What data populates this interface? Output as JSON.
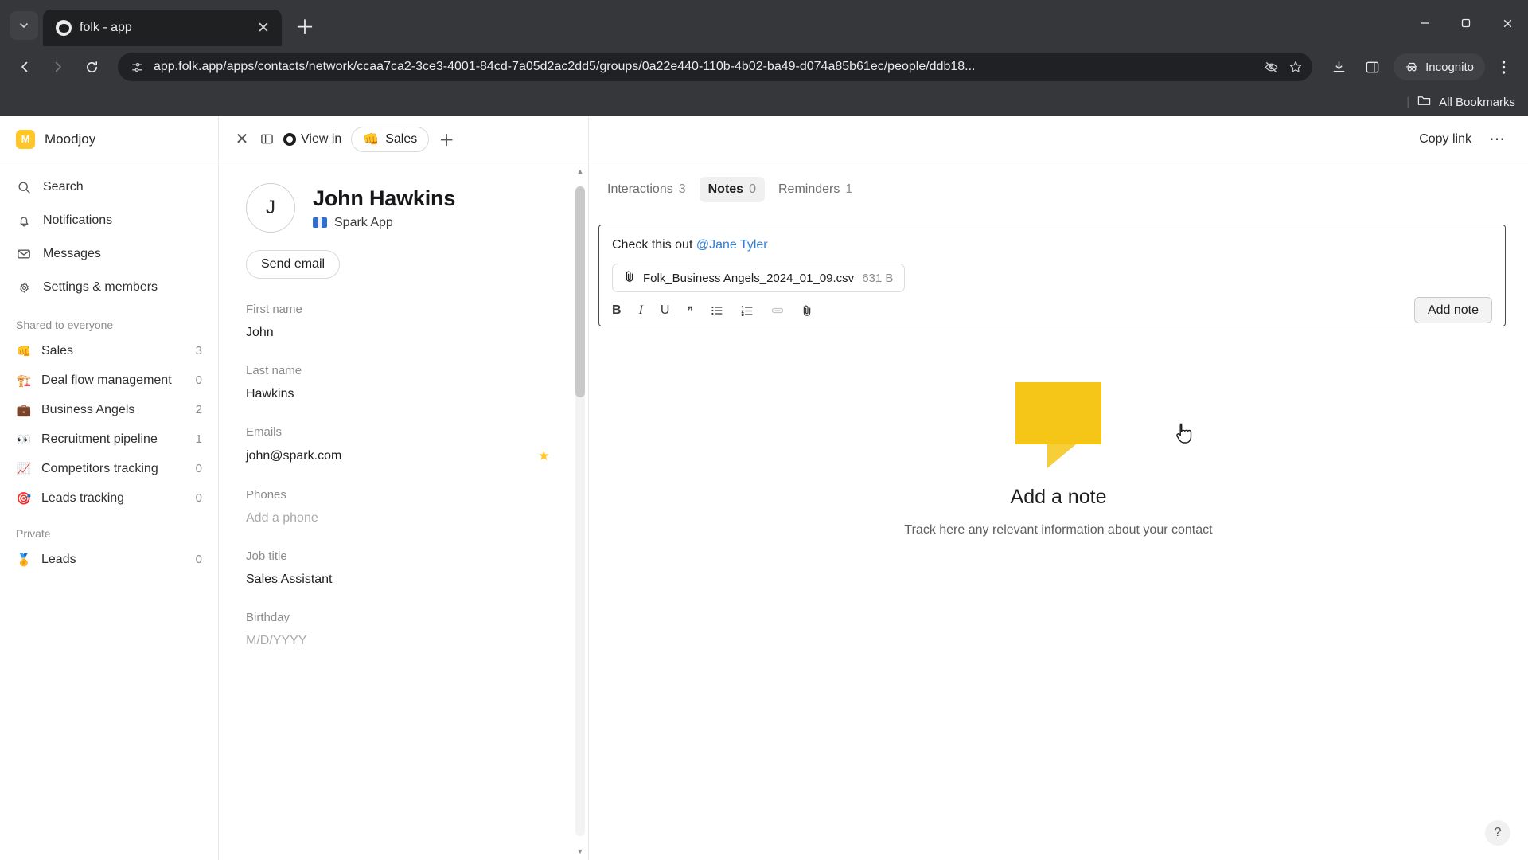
{
  "browser": {
    "tab": {
      "title": "folk - app",
      "favicon_icon": "folk-logo-icon",
      "close_icon": "close-icon"
    },
    "tab_search_icon": "chevron-down-icon",
    "new_tab_icon": "plus-icon",
    "window": {
      "minimize": "minimize-icon",
      "maximize": "maximize-icon",
      "close": "close-icon"
    },
    "nav": {
      "back_icon": "back-arrow-icon",
      "forward_icon": "forward-arrow-icon",
      "reload_icon": "reload-icon"
    },
    "omnibox": {
      "site_info_icon": "page-info-icon",
      "url": "app.folk.app/apps/contacts/network/ccaa7ca2-3ce3-4001-84cd-7a05d2ac2dd5/groups/0a22e440-110b-4b02-ba49-d074a85b61ec/people/ddb18...",
      "tracking_icon": "eye-off-icon",
      "bookmark_icon": "star-icon"
    },
    "actions": {
      "download_icon": "download-icon",
      "side_panel_icon": "side-panel-icon",
      "incognito_label": "Incognito",
      "incognito_icon": "incognito-icon",
      "menu_icon": "kebab-menu-icon"
    },
    "bookmarks_bar": {
      "folder_icon": "folder-icon",
      "label": "All Bookmarks"
    }
  },
  "sidebar": {
    "workspace": {
      "initial": "M",
      "name": "Moodjoy"
    },
    "nav": [
      {
        "label": "Search",
        "icon": "search-icon"
      },
      {
        "label": "Notifications",
        "icon": "bell-icon"
      },
      {
        "label": "Messages",
        "icon": "envelope-icon"
      },
      {
        "label": "Settings & members",
        "icon": "gear-icon"
      }
    ],
    "shared_section_label": "Shared to everyone",
    "shared_groups": [
      {
        "emoji": "👊",
        "label": "Sales",
        "count": "3"
      },
      {
        "emoji": "🏗️",
        "label": "Deal flow management",
        "count": "0"
      },
      {
        "emoji": "💼",
        "label": "Business Angels",
        "count": "2"
      },
      {
        "emoji": "👀",
        "label": "Recruitment pipeline",
        "count": "1"
      },
      {
        "emoji": "📈",
        "label": "Competitors tracking",
        "count": "0"
      },
      {
        "emoji": "🎯",
        "label": "Leads tracking",
        "count": "0"
      }
    ],
    "private_section_label": "Private",
    "private_groups": [
      {
        "emoji": "🏅",
        "label": "Leads",
        "count": "0"
      }
    ]
  },
  "contact_pane": {
    "toolbar": {
      "close_icon": "close-icon",
      "panel_icon": "split-panel-icon",
      "record_icon": "record-dot-icon",
      "view_in_label": "View in",
      "group_chip": {
        "emoji": "👊",
        "label": "Sales"
      },
      "add_icon": "plus-icon"
    },
    "avatar_initial": "J",
    "name": "John Hawkins",
    "company": "Spark App",
    "company_logo_icon": "spark-app-logo-icon",
    "send_email_label": "Send email",
    "fields": [
      {
        "label": "First name",
        "value": "John",
        "placeholder": false
      },
      {
        "label": "Last name",
        "value": "Hawkins",
        "placeholder": false
      },
      {
        "label": "Emails",
        "value": "john@spark.com",
        "placeholder": false,
        "starred": true
      },
      {
        "label": "Phones",
        "value": "Add a phone",
        "placeholder": true
      },
      {
        "label": "Job title",
        "value": "Sales Assistant",
        "placeholder": false
      },
      {
        "label": "Birthday",
        "value": "M/D/YYYY",
        "placeholder": true
      }
    ]
  },
  "right_pane": {
    "copy_link_label": "Copy link",
    "more_icon": "ellipsis-icon",
    "tabs": [
      {
        "label": "Interactions",
        "count": "3",
        "active": false
      },
      {
        "label": "Notes",
        "count": "0",
        "active": true
      },
      {
        "label": "Reminders",
        "count": "1",
        "active": false
      }
    ],
    "composer": {
      "text_prefix": "Check this out ",
      "mention": "@Jane Tyler",
      "attachment": {
        "icon": "paperclip-icon",
        "filename": "Folk_Business Angels_2024_01_09.csv",
        "size": "631 B"
      },
      "toolbar": [
        {
          "name": "bold",
          "glyph": "B",
          "disabled": false
        },
        {
          "name": "italic",
          "glyph": "I",
          "disabled": false
        },
        {
          "name": "underline",
          "glyph": "U",
          "disabled": false
        },
        {
          "name": "quote",
          "glyph": "❞",
          "disabled": false
        },
        {
          "name": "bullet-list",
          "glyph": "☰",
          "disabled": false
        },
        {
          "name": "numbered-list",
          "glyph": "☷",
          "disabled": false
        },
        {
          "name": "link",
          "glyph": "🔗",
          "disabled": true
        },
        {
          "name": "attachment",
          "glyph": "📎",
          "disabled": false
        }
      ],
      "submit_label": "Add note"
    },
    "empty_state": {
      "illustration_icon": "speech-bubble-illustration",
      "illustration_color": "#F5C518",
      "title": "Add a note",
      "subtitle": "Track here any relevant information about your contact"
    },
    "help_label": "?"
  }
}
